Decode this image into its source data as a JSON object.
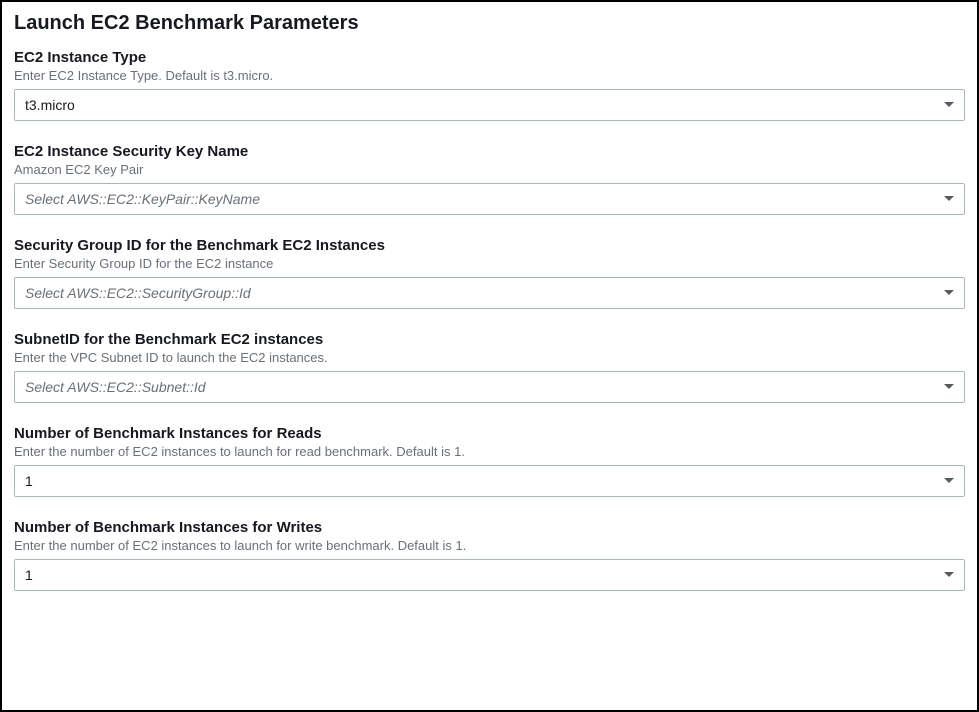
{
  "section_title": "Launch EC2 Benchmark Parameters",
  "fields": {
    "instance_type": {
      "label": "EC2 Instance Type",
      "description": "Enter EC2 Instance Type. Default is t3.micro.",
      "value": "t3.micro",
      "is_placeholder": false
    },
    "security_key": {
      "label": "EC2 Instance Security Key Name",
      "description": "Amazon EC2 Key Pair",
      "value": "Select AWS::EC2::KeyPair::KeyName",
      "is_placeholder": true
    },
    "security_group": {
      "label": "Security Group ID for the Benchmark EC2 Instances",
      "description": "Enter Security Group ID for the EC2 instance",
      "value": "Select AWS::EC2::SecurityGroup::Id",
      "is_placeholder": true
    },
    "subnet_id": {
      "label": "SubnetID for the Benchmark EC2 instances",
      "description": "Enter the VPC Subnet ID to launch the EC2 instances.",
      "value": "Select AWS::EC2::Subnet::Id",
      "is_placeholder": true
    },
    "read_instances": {
      "label": "Number of Benchmark Instances for Reads",
      "description": "Enter the number of EC2 instances to launch for read benchmark. Default is 1.",
      "value": "1",
      "is_placeholder": false
    },
    "write_instances": {
      "label": "Number of Benchmark Instances for Writes",
      "description": "Enter the number of EC2 instances to launch for write benchmark. Default is 1.",
      "value": "1",
      "is_placeholder": false
    }
  }
}
